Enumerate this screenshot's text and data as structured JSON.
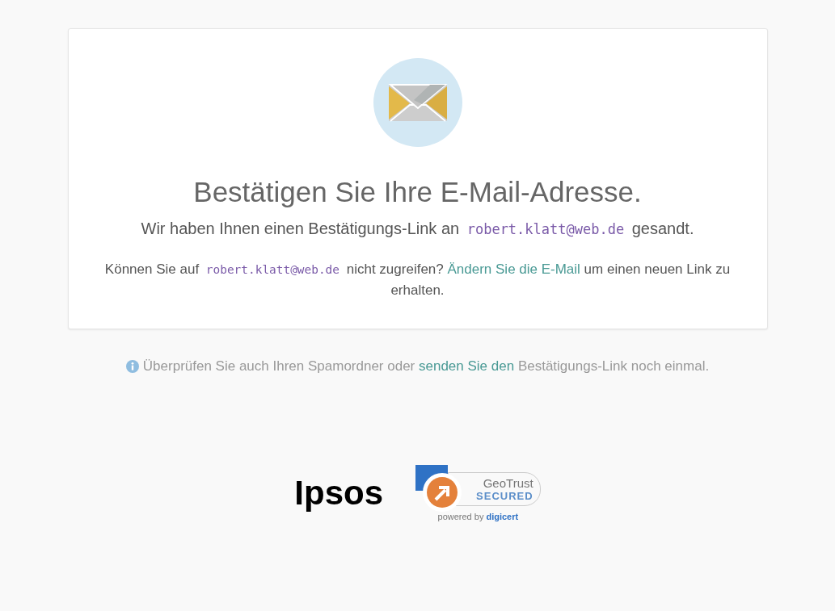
{
  "card": {
    "title": "Bestätigen Sie Ihre E-Mail-Adresse.",
    "sent_line": {
      "before": "Wir haben Ihnen einen Bestätigungs-Link an",
      "email": "robert.klatt@web.de",
      "after": "gesandt."
    },
    "access_line": {
      "before": "Können Sie auf",
      "email": "robert.klatt@web.de",
      "middle": "nicht zugreifen?",
      "link": "Ändern Sie die E-Mail",
      "after": "um einen neuen Link zu erhalten."
    }
  },
  "hint": {
    "before": "Überprüfen Sie auch Ihren Spamordner oder",
    "link": "senden Sie den",
    "after": "Bestätigungs-Link noch einmal."
  },
  "footer": {
    "logo": "Ipsos",
    "badge": {
      "brand": "GeoTrust",
      "status": "SECURED",
      "powered": "powered by",
      "vendor": "digicert"
    }
  }
}
